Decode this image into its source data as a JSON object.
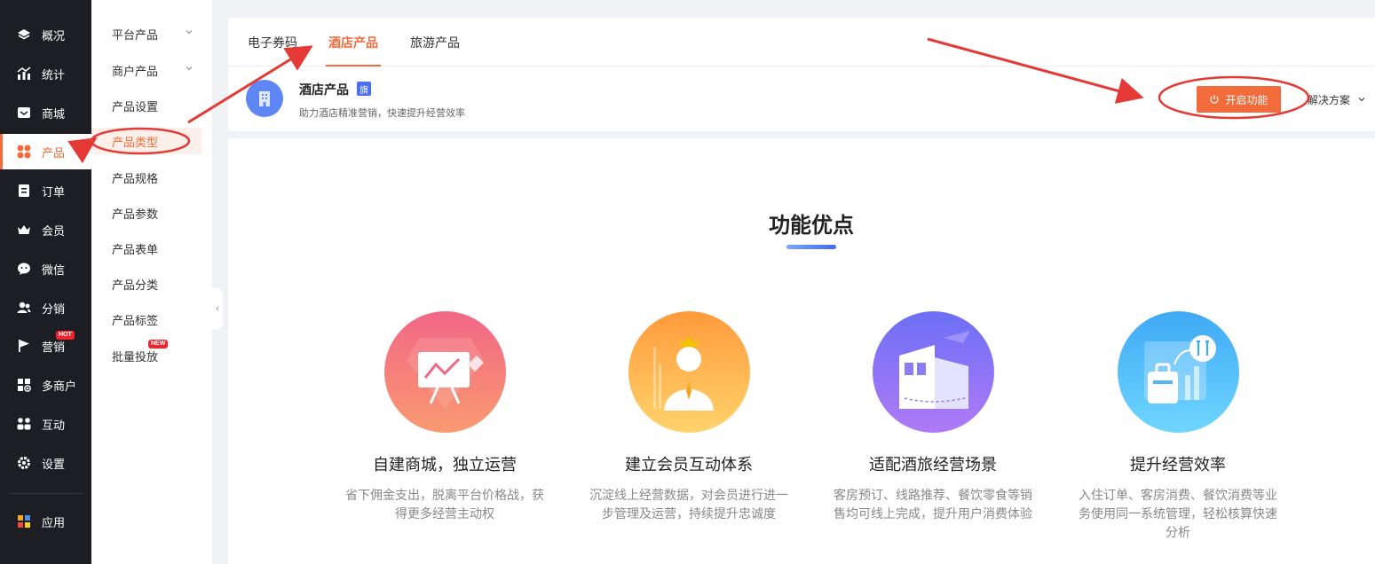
{
  "sidebar": {
    "items": [
      {
        "label": "概况",
        "icon": "layers-icon"
      },
      {
        "label": "统计",
        "icon": "chart-icon"
      },
      {
        "label": "商城",
        "icon": "mail-icon"
      },
      {
        "label": "产品",
        "icon": "grid-flower-icon"
      },
      {
        "label": "订单",
        "icon": "clipboard-icon"
      },
      {
        "label": "会员",
        "icon": "crown-icon"
      },
      {
        "label": "微信",
        "icon": "wechat-icon"
      },
      {
        "label": "分销",
        "icon": "users-icon"
      },
      {
        "label": "营销",
        "icon": "flag-icon",
        "badge": "HOT"
      },
      {
        "label": "多商户",
        "icon": "store-plus-icon"
      },
      {
        "label": "互动",
        "icon": "people-icon"
      },
      {
        "label": "设置",
        "icon": "gear-icon"
      },
      {
        "label": "应用",
        "icon": "apps-icon"
      }
    ],
    "active": "产品"
  },
  "submenu": {
    "items": [
      {
        "label": "平台产品",
        "expandable": true
      },
      {
        "label": "商户产品",
        "expandable": true
      },
      {
        "label": "产品设置"
      },
      {
        "label": "产品类型"
      },
      {
        "label": "产品规格"
      },
      {
        "label": "产品参数"
      },
      {
        "label": "产品表单"
      },
      {
        "label": "产品分类"
      },
      {
        "label": "产品标签"
      },
      {
        "label": "批量投放",
        "badge": "NEW"
      }
    ],
    "active": "产品类型"
  },
  "tabs": {
    "items": [
      "电子券码",
      "酒店产品",
      "旅游产品"
    ],
    "active": "酒店产品"
  },
  "product": {
    "name": "酒店产品",
    "flag": "旗",
    "description": "助力酒店精准营销，快速提升经营效率",
    "enable_label": "开启功能",
    "solution_label": "解决方案"
  },
  "features": {
    "title": "功能优点",
    "items": [
      {
        "title": "自建商城，独立运营",
        "desc": "省下佣金支出，脱离平台价格战，获得更多经营主动权",
        "icon": "presentation-gem-icon"
      },
      {
        "title": "建立会员互动体系",
        "desc": "沉淀线上经营数据，对会员进行进一步管理及运营，持续提升忠诚度",
        "icon": "vip-member-icon"
      },
      {
        "title": "适配酒旅经营场景",
        "desc": "客房预订、线路推荐、餐饮零食等销售均可线上完成，提升用户消费体验",
        "icon": "hotel-travel-icon"
      },
      {
        "title": "提升经营效率",
        "desc": "入住订单、客房消费、餐饮消费等业务使用同一系统管理，轻松核算快速分析",
        "icon": "luggage-dining-icon"
      }
    ]
  },
  "colors": {
    "accent": "#f26b3a",
    "sidebar_bg": "#1d1e23",
    "annotation": "#e53935"
  }
}
